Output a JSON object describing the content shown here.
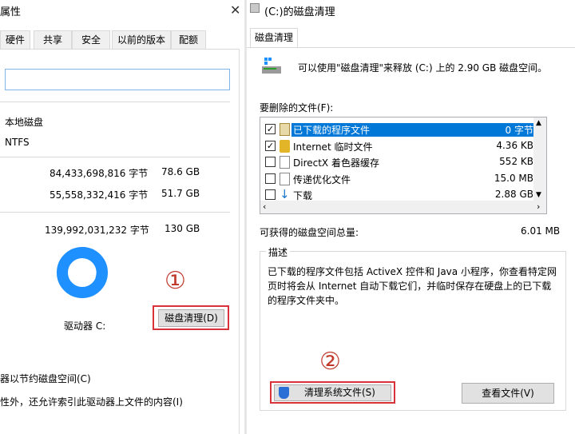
{
  "left": {
    "title": "属性",
    "tabs": [
      "硬件",
      "共享",
      "安全",
      "以前的版本",
      "配额"
    ],
    "type_label": "本地磁盘",
    "filesystem": "NTFS",
    "used_bytes": "84,433,698,816 字节",
    "used_size": "78.6 GB",
    "free_bytes": "55,558,332,416 字节",
    "free_size": "51.7 GB",
    "capacity_bytes": "139,992,031,232 字节",
    "capacity_size": "130 GB",
    "drive_label": "驱动器 C:",
    "cleanup_button": "磁盘清理(D)",
    "annotation_1": "①",
    "compress_option": "器以节约磁盘空间(C)",
    "index_option": "性外，还允许索引此驱动器上文件的内容(I)"
  },
  "right": {
    "title": "(C:)的磁盘清理",
    "tab": "磁盘清理",
    "intro": "可以使用\"磁盘清理\"来释放 (C:) 上的 2.90 GB 磁盘空间。",
    "files_label": "要删除的文件(F):",
    "files": [
      {
        "name": "已下载的程序文件",
        "size": "0 字节",
        "checked": true,
        "selected": true,
        "icon": "folder-icon"
      },
      {
        "name": "Internet 临时文件",
        "size": "4.36 KB",
        "checked": true,
        "selected": false,
        "icon": "lock-icon"
      },
      {
        "name": "DirectX 着色器缓存",
        "size": "552 KB",
        "checked": false,
        "selected": false,
        "icon": "file-icon"
      },
      {
        "name": "传递优化文件",
        "size": "15.0 MB",
        "checked": false,
        "selected": false,
        "icon": "file-icon"
      },
      {
        "name": "下载",
        "size": "2.88 GB",
        "checked": false,
        "selected": false,
        "icon": "download-icon"
      }
    ],
    "total_label": "可获得的磁盘空间总量:",
    "total_value": "6.01 MB",
    "desc_label": "描述",
    "desc_text": "已下载的程序文件包括 ActiveX 控件和 Java 小程序，你查看特定网页时将会从 Internet 自动下载它们，并临时保存在硬盘上的已下载的程序文件夹中。",
    "clean_system_button": "清理系统文件(S)",
    "view_files_button": "查看文件(V)",
    "annotation_2": "②"
  },
  "colors": {
    "accent": "#0078d7",
    "annotation": "#d9333a",
    "donut": "#1e90ff"
  }
}
